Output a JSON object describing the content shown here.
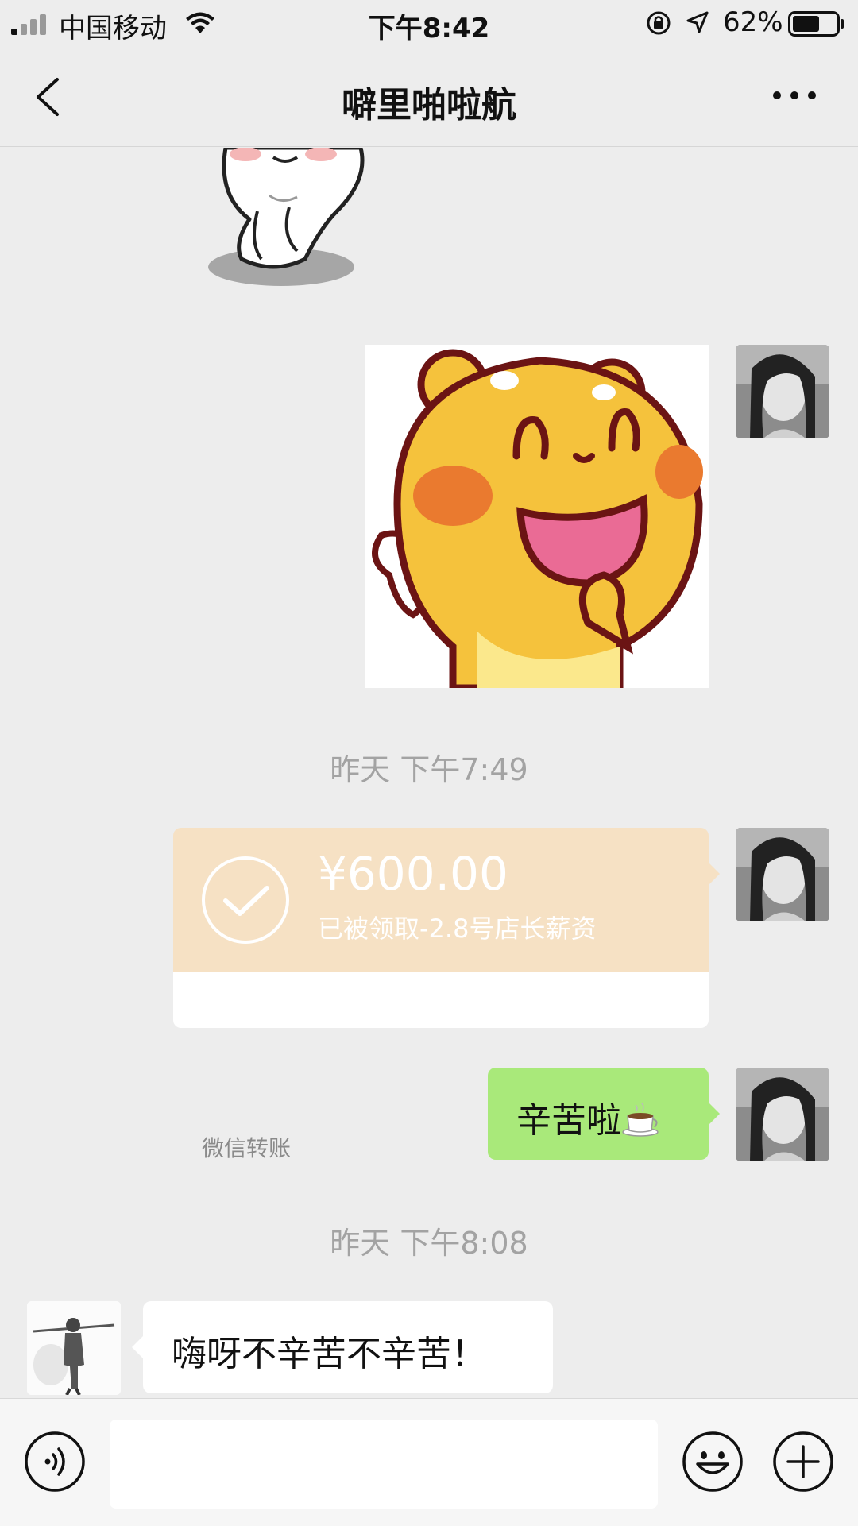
{
  "status_bar": {
    "carrier": "中国移动",
    "time": "下午8:42",
    "battery_percent": "62%",
    "battery_level": 0.62
  },
  "nav": {
    "title": "噼里啪啦航"
  },
  "messages": {
    "timestamp_1": "昨天 下午7:49",
    "transfer": {
      "amount": "¥600.00",
      "description": "已被领取-2.8号店长薪资",
      "type_label": "微信转账"
    },
    "outgoing_text": "辛苦啦",
    "timestamp_2": "昨天 下午8:08",
    "incoming_text": "嗨呀不辛苦不辛苦！"
  },
  "input_bar": {
    "placeholder": ""
  },
  "colors": {
    "background": "#ededed",
    "outgoing_bubble": "#a9e97a",
    "transfer_card": "#f6e1c4",
    "timestamp_text": "#a3a3a3"
  }
}
